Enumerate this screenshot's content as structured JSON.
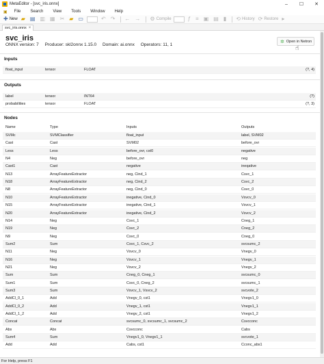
{
  "window": {
    "title": "MetaEditor - [svc_iris.onnx]",
    "minimize": "–",
    "maximize": "☐",
    "close": "✕"
  },
  "menu": [
    "File",
    "Search",
    "View",
    "Tools",
    "Window",
    "Help"
  ],
  "toolbar": {
    "new_label": "New",
    "compile_label": "Compile",
    "history_label": "History",
    "restore_label": "Restore"
  },
  "tab": {
    "label": "svc_iris.onnx",
    "close": "×"
  },
  "model": {
    "name": "svc_iris",
    "onnx_version": "ONNX version: 7",
    "producer": "Producer: skl2onnx 1.15.0",
    "domain": "Domain: ai.onnx",
    "operators": "Operators: 11, 1",
    "open_netron_label": "Open in Netron"
  },
  "inputs": {
    "heading": "Inputs",
    "rows": [
      {
        "name": "float_input",
        "kind": "tensor",
        "type": "FLOAT",
        "shape": "(?, 4)"
      }
    ]
  },
  "outputs": {
    "heading": "Outputs",
    "rows": [
      {
        "name": "label",
        "kind": "tensor",
        "type": "INT64",
        "shape": "(?)"
      },
      {
        "name": "probabilities",
        "kind": "tensor",
        "type": "FLOAT",
        "shape": "(?, 3)"
      }
    ]
  },
  "nodes": {
    "heading": "Nodes",
    "columns": {
      "name": "Name",
      "type": "Type",
      "inputs": "Inputs",
      "outputs": "Outputs"
    },
    "rows": [
      {
        "name": "SVMc",
        "type": "SVMClassifier",
        "inputs": "float_input",
        "outputs": "label, SVM02"
      },
      {
        "name": "Cast",
        "type": "Cast",
        "inputs": "SVM02",
        "outputs": "before_ovr"
      },
      {
        "name": "Less",
        "type": "Less",
        "inputs": "before_ovr, cst0",
        "outputs": "negative"
      },
      {
        "name": "N4",
        "type": "Neg",
        "inputs": "before_ovr",
        "outputs": "neg"
      },
      {
        "name": "Cast1",
        "type": "Cast",
        "inputs": "negative",
        "outputs": "ineqative"
      },
      {
        "name": "N13",
        "type": "ArrayFeatureExtractor",
        "inputs": "neg, Cind_1",
        "outputs": "Csvc_1"
      },
      {
        "name": "N18",
        "type": "ArrayFeatureExtractor",
        "inputs": "neg, Cind_2",
        "outputs": "Csvc_2"
      },
      {
        "name": "N8",
        "type": "ArrayFeatureExtractor",
        "inputs": "neg, Cind_0",
        "outputs": "Csvc_0"
      },
      {
        "name": "N10",
        "type": "ArrayFeatureExtractor",
        "inputs": "inegative, Cind_0",
        "outputs": "Vsvcv_0"
      },
      {
        "name": "N15",
        "type": "ArrayFeatureExtractor",
        "inputs": "inegative, Cind_1",
        "outputs": "Vsvcv_1"
      },
      {
        "name": "N20",
        "type": "ArrayFeatureExtractor",
        "inputs": "inegative, Cind_2",
        "outputs": "Vsvcv_2"
      },
      {
        "name": "N14",
        "type": "Neg",
        "inputs": "Csvc_1",
        "outputs": "Cneg_1"
      },
      {
        "name": "N19",
        "type": "Neg",
        "inputs": "Csvc_2",
        "outputs": "Cneg_2"
      },
      {
        "name": "N9",
        "type": "Neg",
        "inputs": "Csvc_0",
        "outputs": "Cneg_0"
      },
      {
        "name": "Sum2",
        "type": "Sum",
        "inputs": "Csvc_1, Csvc_2",
        "outputs": "svcsumc_2"
      },
      {
        "name": "N11",
        "type": "Neg",
        "inputs": "Vsvcv_0",
        "outputs": "Vnegv_0"
      },
      {
        "name": "N16",
        "type": "Neg",
        "inputs": "Vsvcv_1",
        "outputs": "Vnegv_1"
      },
      {
        "name": "N21",
        "type": "Neg",
        "inputs": "Vsvcv_2",
        "outputs": "Vnegv_2"
      },
      {
        "name": "Sum",
        "type": "Sum",
        "inputs": "Cneg_0, Cneg_1",
        "outputs": "svcsumc_0"
      },
      {
        "name": "Sum1",
        "type": "Sum",
        "inputs": "Csvc_0, Cneg_2",
        "outputs": "svcsumc_1"
      },
      {
        "name": "Sum3",
        "type": "Sum",
        "inputs": "Vsvcv_1, Vsvcv_2",
        "outputs": "svcvote_2"
      },
      {
        "name": "AddCl_0_1",
        "type": "Add",
        "inputs": "Vnegv_0, cst1",
        "outputs": "Vnegv1_0"
      },
      {
        "name": "AddCl_0_2",
        "type": "Add",
        "inputs": "Vnegv_1, cst1",
        "outputs": "Vnegv1_1"
      },
      {
        "name": "AddCl_1_2",
        "type": "Add",
        "inputs": "Vnegv_2, cst1",
        "outputs": "Vnegv1_2"
      },
      {
        "name": "Concat",
        "type": "Concat",
        "inputs": "svcsumc_0, svcsumc_1, svcsumc_2",
        "outputs": "Csvcconc"
      },
      {
        "name": "Abs",
        "type": "Abs",
        "inputs": "Csvcconc",
        "outputs": "Cabs"
      },
      {
        "name": "Sum4",
        "type": "Sum",
        "inputs": "Vnegv1_0, Vnegv1_1",
        "outputs": "svcvote_1"
      },
      {
        "name": "Add",
        "type": "Add",
        "inputs": "Cabs, cst1",
        "outputs": "Cconc_abs1"
      }
    ]
  },
  "status": {
    "text": "For Help, press F1"
  }
}
